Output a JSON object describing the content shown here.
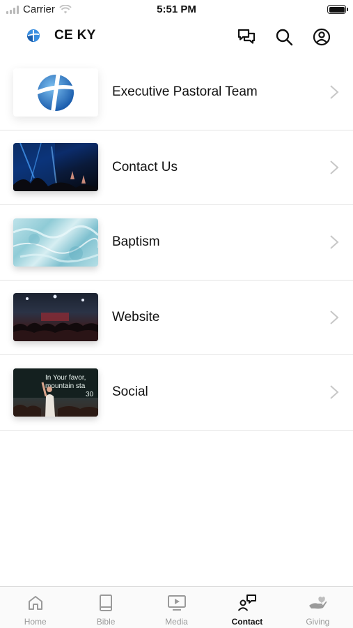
{
  "status_bar": {
    "carrier": "Carrier",
    "time": "5:51 PM"
  },
  "header": {
    "title": "CE KY",
    "icons": [
      "chat-icon",
      "search-icon",
      "profile-icon"
    ]
  },
  "list": {
    "items": [
      {
        "label": "Executive Pastoral Team",
        "thumb": "logo"
      },
      {
        "label": "Contact Us",
        "thumb": "worship-stage"
      },
      {
        "label": "Baptism",
        "thumb": "water"
      },
      {
        "label": "Website",
        "thumb": "crowd"
      },
      {
        "label": "Social",
        "thumb": "speaker",
        "thumb_text": [
          "In Your favor, ",
          "mountain sta",
          "30"
        ]
      }
    ]
  },
  "tabbar": {
    "tabs": [
      {
        "label": "Home",
        "icon": "home-icon",
        "active": false
      },
      {
        "label": "Bible",
        "icon": "book-icon",
        "active": false
      },
      {
        "label": "Media",
        "icon": "play-screen-icon",
        "active": false
      },
      {
        "label": "Contact",
        "icon": "contact-icon",
        "active": true
      },
      {
        "label": "Giving",
        "icon": "giving-hand-icon",
        "active": false
      }
    ]
  },
  "colors": {
    "brand_blue": "#1f6fc4",
    "active_tab": "#111111",
    "inactive_tab": "#9a9a9a"
  }
}
